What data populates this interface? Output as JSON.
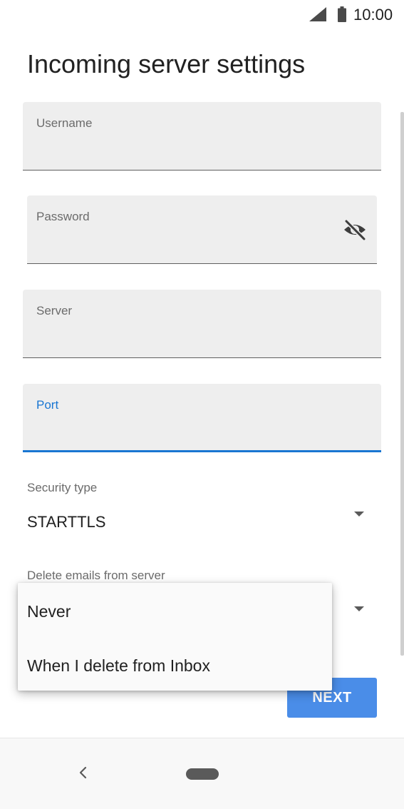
{
  "status_bar": {
    "time": "10:00",
    "signal_icon": "cellular-signal-icon",
    "battery_icon": "battery-icon"
  },
  "page": {
    "title": "Incoming server settings"
  },
  "fields": {
    "username": {
      "label": "Username",
      "value": ""
    },
    "password": {
      "label": "Password",
      "value": "",
      "toggle_icon": "visibility-off-icon"
    },
    "server": {
      "label": "Server",
      "value": ""
    },
    "port": {
      "label": "Port",
      "value": ""
    }
  },
  "security_type": {
    "label": "Security type",
    "value": "STARTTLS"
  },
  "delete_emails": {
    "label": "Delete emails from server",
    "options": [
      "Never",
      "When I delete from Inbox"
    ]
  },
  "actions": {
    "next_label": "NEXT"
  },
  "nav": {
    "back_icon": "back-chevron-icon",
    "home_icon": "home-pill-icon"
  },
  "colors": {
    "accent": "#1976d2",
    "button": "#4a8de8",
    "field_background": "#eeeeee"
  }
}
